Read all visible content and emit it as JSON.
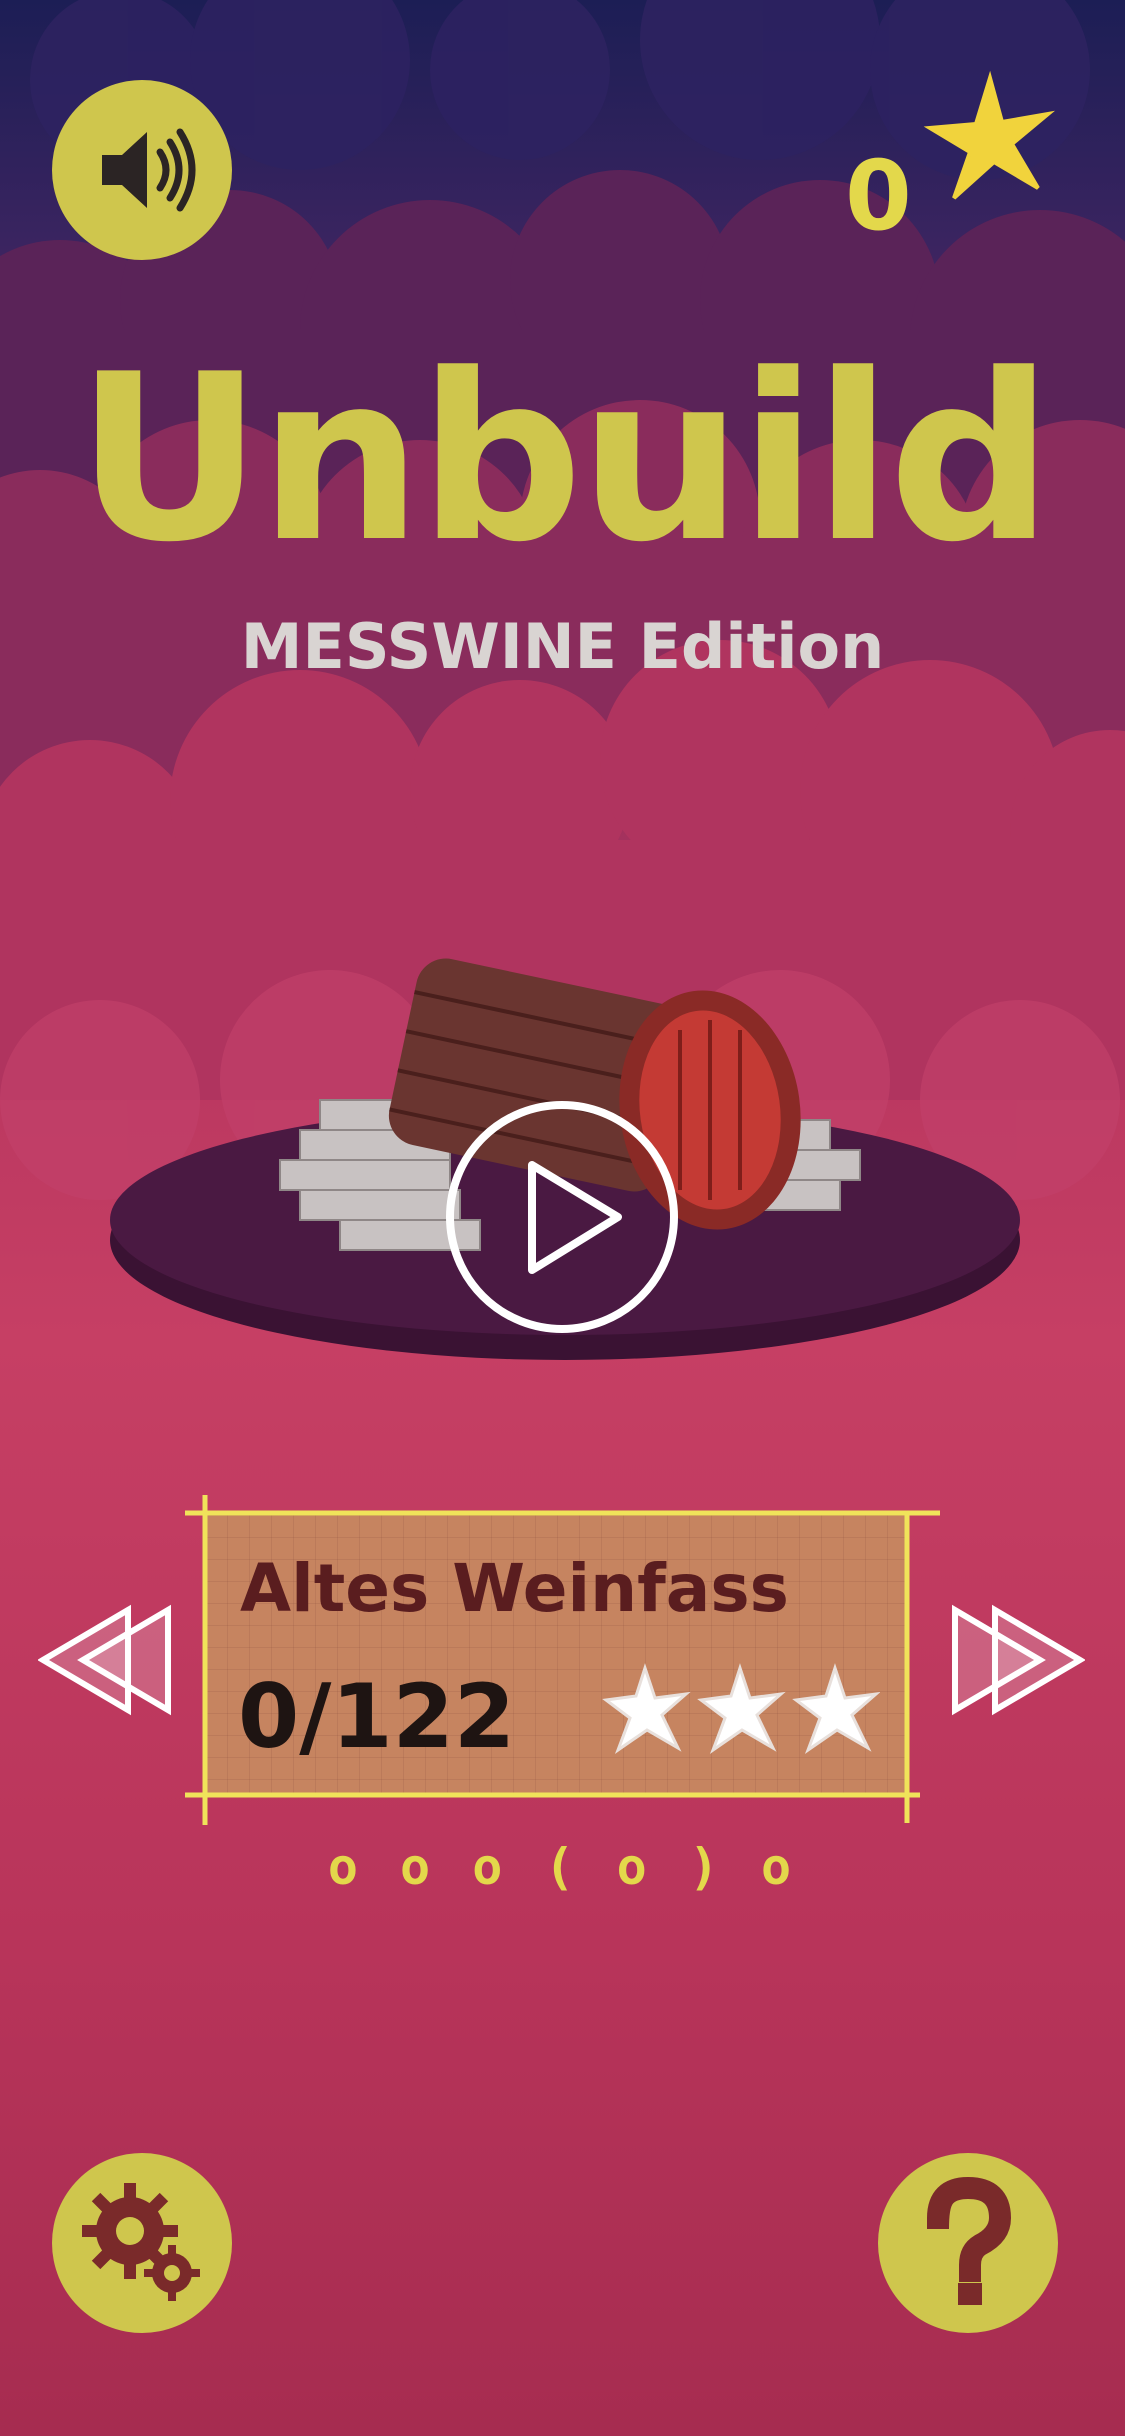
{
  "header": {
    "sound_icon": "speaker-icon",
    "star_count": "0",
    "star_icon": "star-icon"
  },
  "title": {
    "main": "Unbuild",
    "edition": "MESSWINE Edition"
  },
  "preview": {
    "play_icon": "play-icon"
  },
  "level": {
    "name": "Altes Weinfass",
    "progress": "0/122",
    "stars_total": 3,
    "stars_earned": 0,
    "pager": "o o o ( o ) o"
  },
  "nav": {
    "prev_icon": "double-chevron-left-icon",
    "next_icon": "double-chevron-right-icon"
  },
  "footer": {
    "settings_icon": "gear-icon",
    "help_icon": "question-mark-icon"
  },
  "colors": {
    "accent_yellow": "#cfc64d",
    "card": "#c68460",
    "bg_pink": "#c63f64",
    "bg_navy": "#1c1e55"
  }
}
